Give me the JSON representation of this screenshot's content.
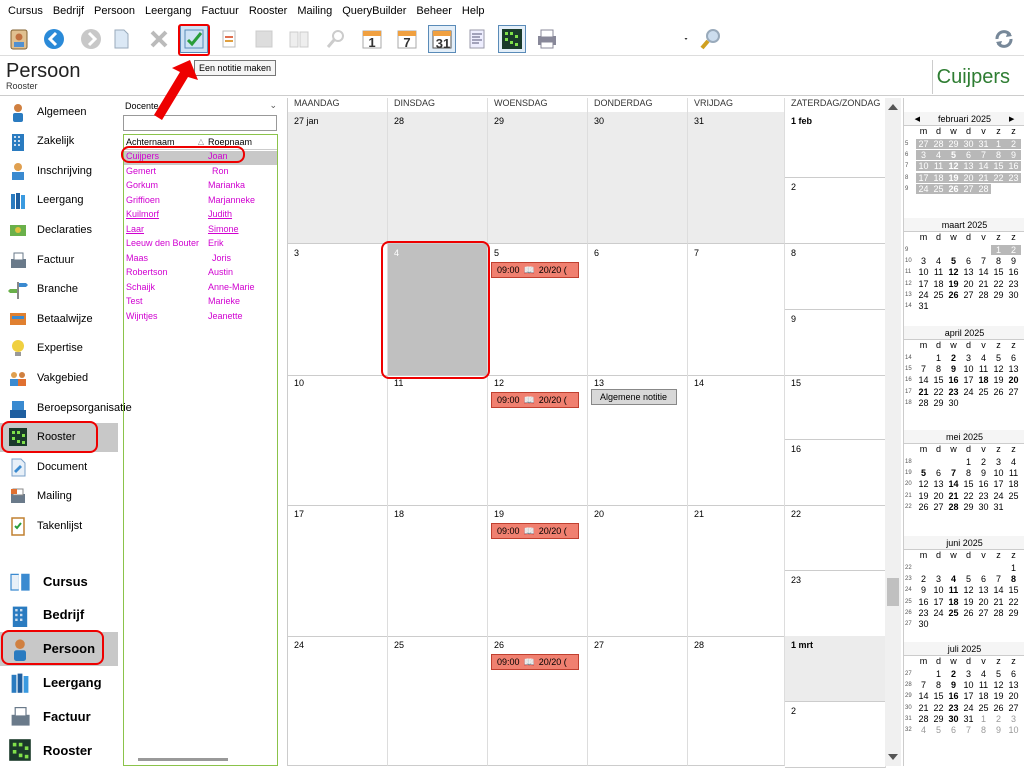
{
  "menu": [
    "Cursus",
    "Bedrijf",
    "Persoon",
    "Leergang",
    "Factuur",
    "Rooster",
    "Mailing",
    "QueryBuilder",
    "Beheer",
    "Help"
  ],
  "toolbar": {
    "icons": [
      "contact-card-icon",
      "back-icon",
      "forward-icon",
      "new-document-icon",
      "delete-icon",
      "make-note-icon",
      "edit-icon",
      "image-icon",
      "book-icon",
      "search-icon",
      "day-view-icon",
      "week-view-icon",
      "month-view-icon",
      "list-icon",
      "schedule-grid-icon",
      "print-icon",
      "dropdown-icon",
      "zoom-icon",
      "refresh-icon"
    ],
    "day_labels": [
      "1",
      "7",
      "31"
    ],
    "tooltip": "Een notitie maken"
  },
  "header": {
    "title": "Persoon",
    "subtitle": "Rooster",
    "name": "Cuijpers"
  },
  "sidebar": {
    "items": [
      {
        "label": "Algemeen",
        "icon": "person-icon"
      },
      {
        "label": "Zakelijk",
        "icon": "building-icon"
      },
      {
        "label": "Inschrijving",
        "icon": "registration-icon"
      },
      {
        "label": "Leergang",
        "icon": "books-icon"
      },
      {
        "label": "Declaraties",
        "icon": "declarations-icon"
      },
      {
        "label": "Factuur",
        "icon": "fax-icon"
      },
      {
        "label": "Branche",
        "icon": "signpost-icon"
      },
      {
        "label": "Betaalwijze",
        "icon": "payment-icon"
      },
      {
        "label": "Expertise",
        "icon": "lightbulb-icon"
      },
      {
        "label": "Vakgebied",
        "icon": "group-icon"
      },
      {
        "label": "Beroepsorganisatie",
        "icon": "organisation-icon"
      },
      {
        "label": "Rooster",
        "icon": "schedule-icon"
      },
      {
        "label": "Document",
        "icon": "document-icon"
      },
      {
        "label": "Mailing",
        "icon": "mailing-icon"
      },
      {
        "label": "Takenlijst",
        "icon": "tasklist-icon"
      }
    ],
    "modules": [
      {
        "label": "Cursus",
        "icon": "book-icon"
      },
      {
        "label": "Bedrijf",
        "icon": "building-icon"
      },
      {
        "label": "Persoon",
        "icon": "person-icon"
      },
      {
        "label": "Leergang",
        "icon": "books-icon"
      },
      {
        "label": "Factuur",
        "icon": "fax-icon"
      },
      {
        "label": "Rooster",
        "icon": "schedule-icon"
      }
    ]
  },
  "list": {
    "filter": "Docente",
    "search": "",
    "columns": [
      "Achternaam",
      "Roepnaam"
    ],
    "rows": [
      [
        "Cuijpers",
        "Joan"
      ],
      [
        "Gemert",
        "Ron"
      ],
      [
        "Gorkum",
        "Marianka"
      ],
      [
        "Griffioen",
        "Marjanneke"
      ],
      [
        "Kuilmorf",
        "Judith"
      ],
      [
        "Laar",
        "Simone"
      ],
      [
        "Leeuw den Bouter",
        "Erik"
      ],
      [
        "Maas",
        "Joris"
      ],
      [
        "Robertson",
        "Austin"
      ],
      [
        "Schaijk",
        "Anne-Marie"
      ],
      [
        "Test",
        "Marieke"
      ],
      [
        "Wijntjes",
        "Jeanette"
      ]
    ]
  },
  "calendar": {
    "days": [
      "MAANDAG",
      "DINSDAG",
      "WOENSDAG",
      "DONDERDAG",
      "VRIJDAG",
      "ZATERDAG/ZONDAG"
    ],
    "weeks": [
      [
        "27 jan",
        "28",
        "29",
        "30",
        "31",
        "1 feb",
        "2"
      ],
      [
        "3",
        "4",
        "5",
        "6",
        "7",
        "8",
        "9"
      ],
      [
        "10",
        "11",
        "12",
        "13",
        "14",
        "15",
        "16"
      ],
      [
        "17",
        "18",
        "19",
        "20",
        "21",
        "22",
        "23"
      ],
      [
        "24",
        "25",
        "26",
        "27",
        "28",
        "1 mrt",
        "2"
      ]
    ],
    "event_text": "09:00",
    "event_room": "20/20 (",
    "note_text": "Algemene notitie"
  },
  "mini": {
    "weekdays": [
      "m",
      "d",
      "w",
      "d",
      "v",
      "z",
      "z"
    ],
    "months": [
      {
        "title": "februari 2025",
        "weeks": [
          [
            "5",
            "27",
            "28",
            "29",
            "30",
            "31",
            "1",
            "2"
          ],
          [
            "6",
            "3",
            "4",
            "5",
            "6",
            "7",
            "8",
            "9"
          ],
          [
            "7",
            "10",
            "11",
            "12",
            "13",
            "14",
            "15",
            "16"
          ],
          [
            "8",
            "17",
            "18",
            "19",
            "20",
            "21",
            "22",
            "23"
          ],
          [
            "9",
            "24",
            "25",
            "26",
            "27",
            "28",
            "",
            ""
          ]
        ]
      },
      {
        "title": "maart 2025",
        "weeks": [
          [
            "9",
            "",
            "",
            "",
            "",
            "",
            "1",
            "2"
          ],
          [
            "10",
            "3",
            "4",
            "5",
            "6",
            "7",
            "8",
            "9"
          ],
          [
            "11",
            "10",
            "11",
            "12",
            "13",
            "14",
            "15",
            "16"
          ],
          [
            "12",
            "17",
            "18",
            "19",
            "20",
            "21",
            "22",
            "23"
          ],
          [
            "13",
            "24",
            "25",
            "26",
            "27",
            "28",
            "29",
            "30"
          ],
          [
            "14",
            "31",
            "",
            "",
            "",
            "",
            "",
            ""
          ]
        ]
      },
      {
        "title": "april 2025",
        "weeks": [
          [
            "14",
            "",
            "1",
            "2",
            "3",
            "4",
            "5",
            "6"
          ],
          [
            "15",
            "7",
            "8",
            "9",
            "10",
            "11",
            "12",
            "13"
          ],
          [
            "16",
            "14",
            "15",
            "16",
            "17",
            "18",
            "19",
            "20"
          ],
          [
            "17",
            "21",
            "22",
            "23",
            "24",
            "25",
            "26",
            "27"
          ],
          [
            "18",
            "28",
            "29",
            "30",
            "",
            "",
            "",
            ""
          ]
        ]
      },
      {
        "title": "mei 2025",
        "weeks": [
          [
            "18",
            "",
            "",
            "",
            "1",
            "2",
            "3",
            "4"
          ],
          [
            "19",
            "5",
            "6",
            "7",
            "8",
            "9",
            "10",
            "11"
          ],
          [
            "20",
            "12",
            "13",
            "14",
            "15",
            "16",
            "17",
            "18"
          ],
          [
            "21",
            "19",
            "20",
            "21",
            "22",
            "23",
            "24",
            "25"
          ],
          [
            "22",
            "26",
            "27",
            "28",
            "29",
            "30",
            "31",
            ""
          ]
        ]
      },
      {
        "title": "juni 2025",
        "weeks": [
          [
            "22",
            "",
            "",
            "",
            "",
            "",
            "",
            "1"
          ],
          [
            "23",
            "2",
            "3",
            "4",
            "5",
            "6",
            "7",
            "8"
          ],
          [
            "24",
            "9",
            "10",
            "11",
            "12",
            "13",
            "14",
            "15"
          ],
          [
            "25",
            "16",
            "17",
            "18",
            "19",
            "20",
            "21",
            "22"
          ],
          [
            "26",
            "23",
            "24",
            "25",
            "26",
            "27",
            "28",
            "29"
          ],
          [
            "27",
            "30",
            "",
            "",
            "",
            "",
            "",
            ""
          ]
        ]
      },
      {
        "title": "juli 2025",
        "weeks": [
          [
            "27",
            "",
            "1",
            "2",
            "3",
            "4",
            "5",
            "6"
          ],
          [
            "28",
            "7",
            "8",
            "9",
            "10",
            "11",
            "12",
            "13"
          ],
          [
            "29",
            "14",
            "15",
            "16",
            "17",
            "18",
            "19",
            "20"
          ],
          [
            "30",
            "21",
            "22",
            "23",
            "24",
            "25",
            "26",
            "27"
          ],
          [
            "31",
            "28",
            "29",
            "30",
            "31",
            "1",
            "2",
            "3"
          ],
          [
            "32",
            "4",
            "5",
            "6",
            "7",
            "8",
            "9",
            "10"
          ]
        ]
      }
    ]
  }
}
